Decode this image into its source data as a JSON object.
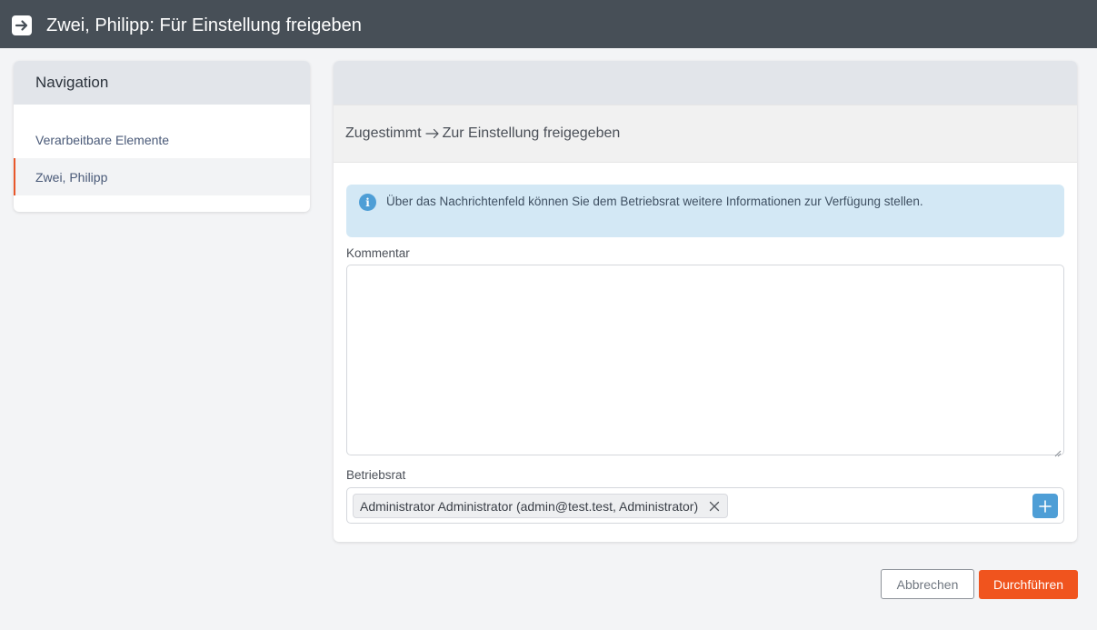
{
  "header": {
    "icon": "arrow-right-box-icon",
    "title": "Zwei, Philipp: Für Einstellung freigeben"
  },
  "navigation": {
    "title": "Navigation",
    "items": [
      {
        "label": "Verarbeitbare Elemente"
      },
      {
        "label": "Zwei, Philipp",
        "active": true
      }
    ],
    "active_color": "#e8572a"
  },
  "transition": {
    "from": "Zugestimmt",
    "to": "Zur Einstellung freigegeben",
    "icon": "arrow-right-icon"
  },
  "info": {
    "icon": "info-icon",
    "text": "Über das Nachrichtenfeld können Sie dem Betriebsrat weitere Informationen zur Verfügung stellen."
  },
  "form": {
    "comment_label": "Kommentar",
    "comment_value": "",
    "council_label": "Betriebsrat",
    "council_tags": [
      {
        "label": "Administrator Administrator (admin@test.test, Administrator)"
      }
    ]
  },
  "actions": {
    "cancel_label": "Abbrechen",
    "submit_label": "Durchführen",
    "submit_color": "#f0541e"
  }
}
